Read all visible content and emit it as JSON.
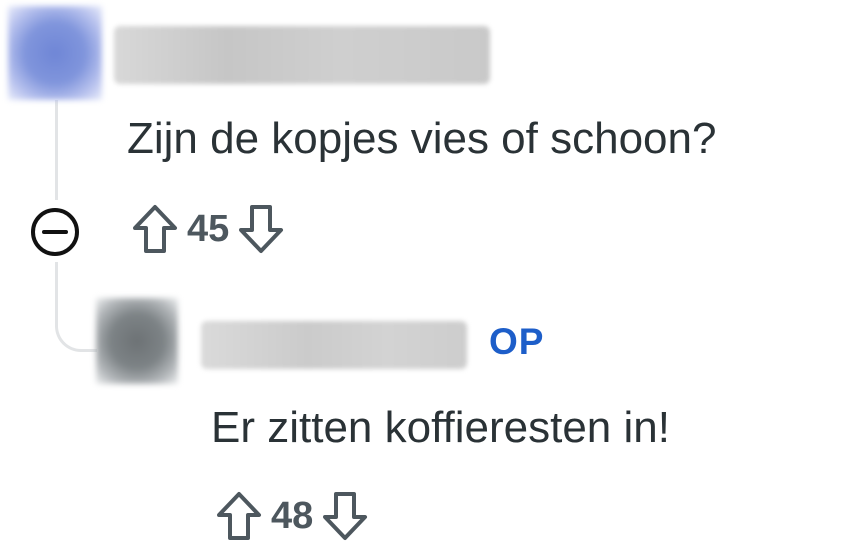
{
  "comments": [
    {
      "text": "Zijn de kopjes vies of schoon?",
      "score": "45"
    },
    {
      "badge": "OP",
      "text": "Er zitten koffieresten in!",
      "score": "48"
    }
  ],
  "icons": {
    "upvote": "arrow-up-outline-icon",
    "downvote": "arrow-down-outline-icon",
    "collapse": "minus-circle-icon"
  },
  "colors": {
    "op_badge": "#1d5ec9",
    "text": "#2a3236",
    "muted": "#4d575e",
    "thread_line": "#e2e4e6"
  }
}
